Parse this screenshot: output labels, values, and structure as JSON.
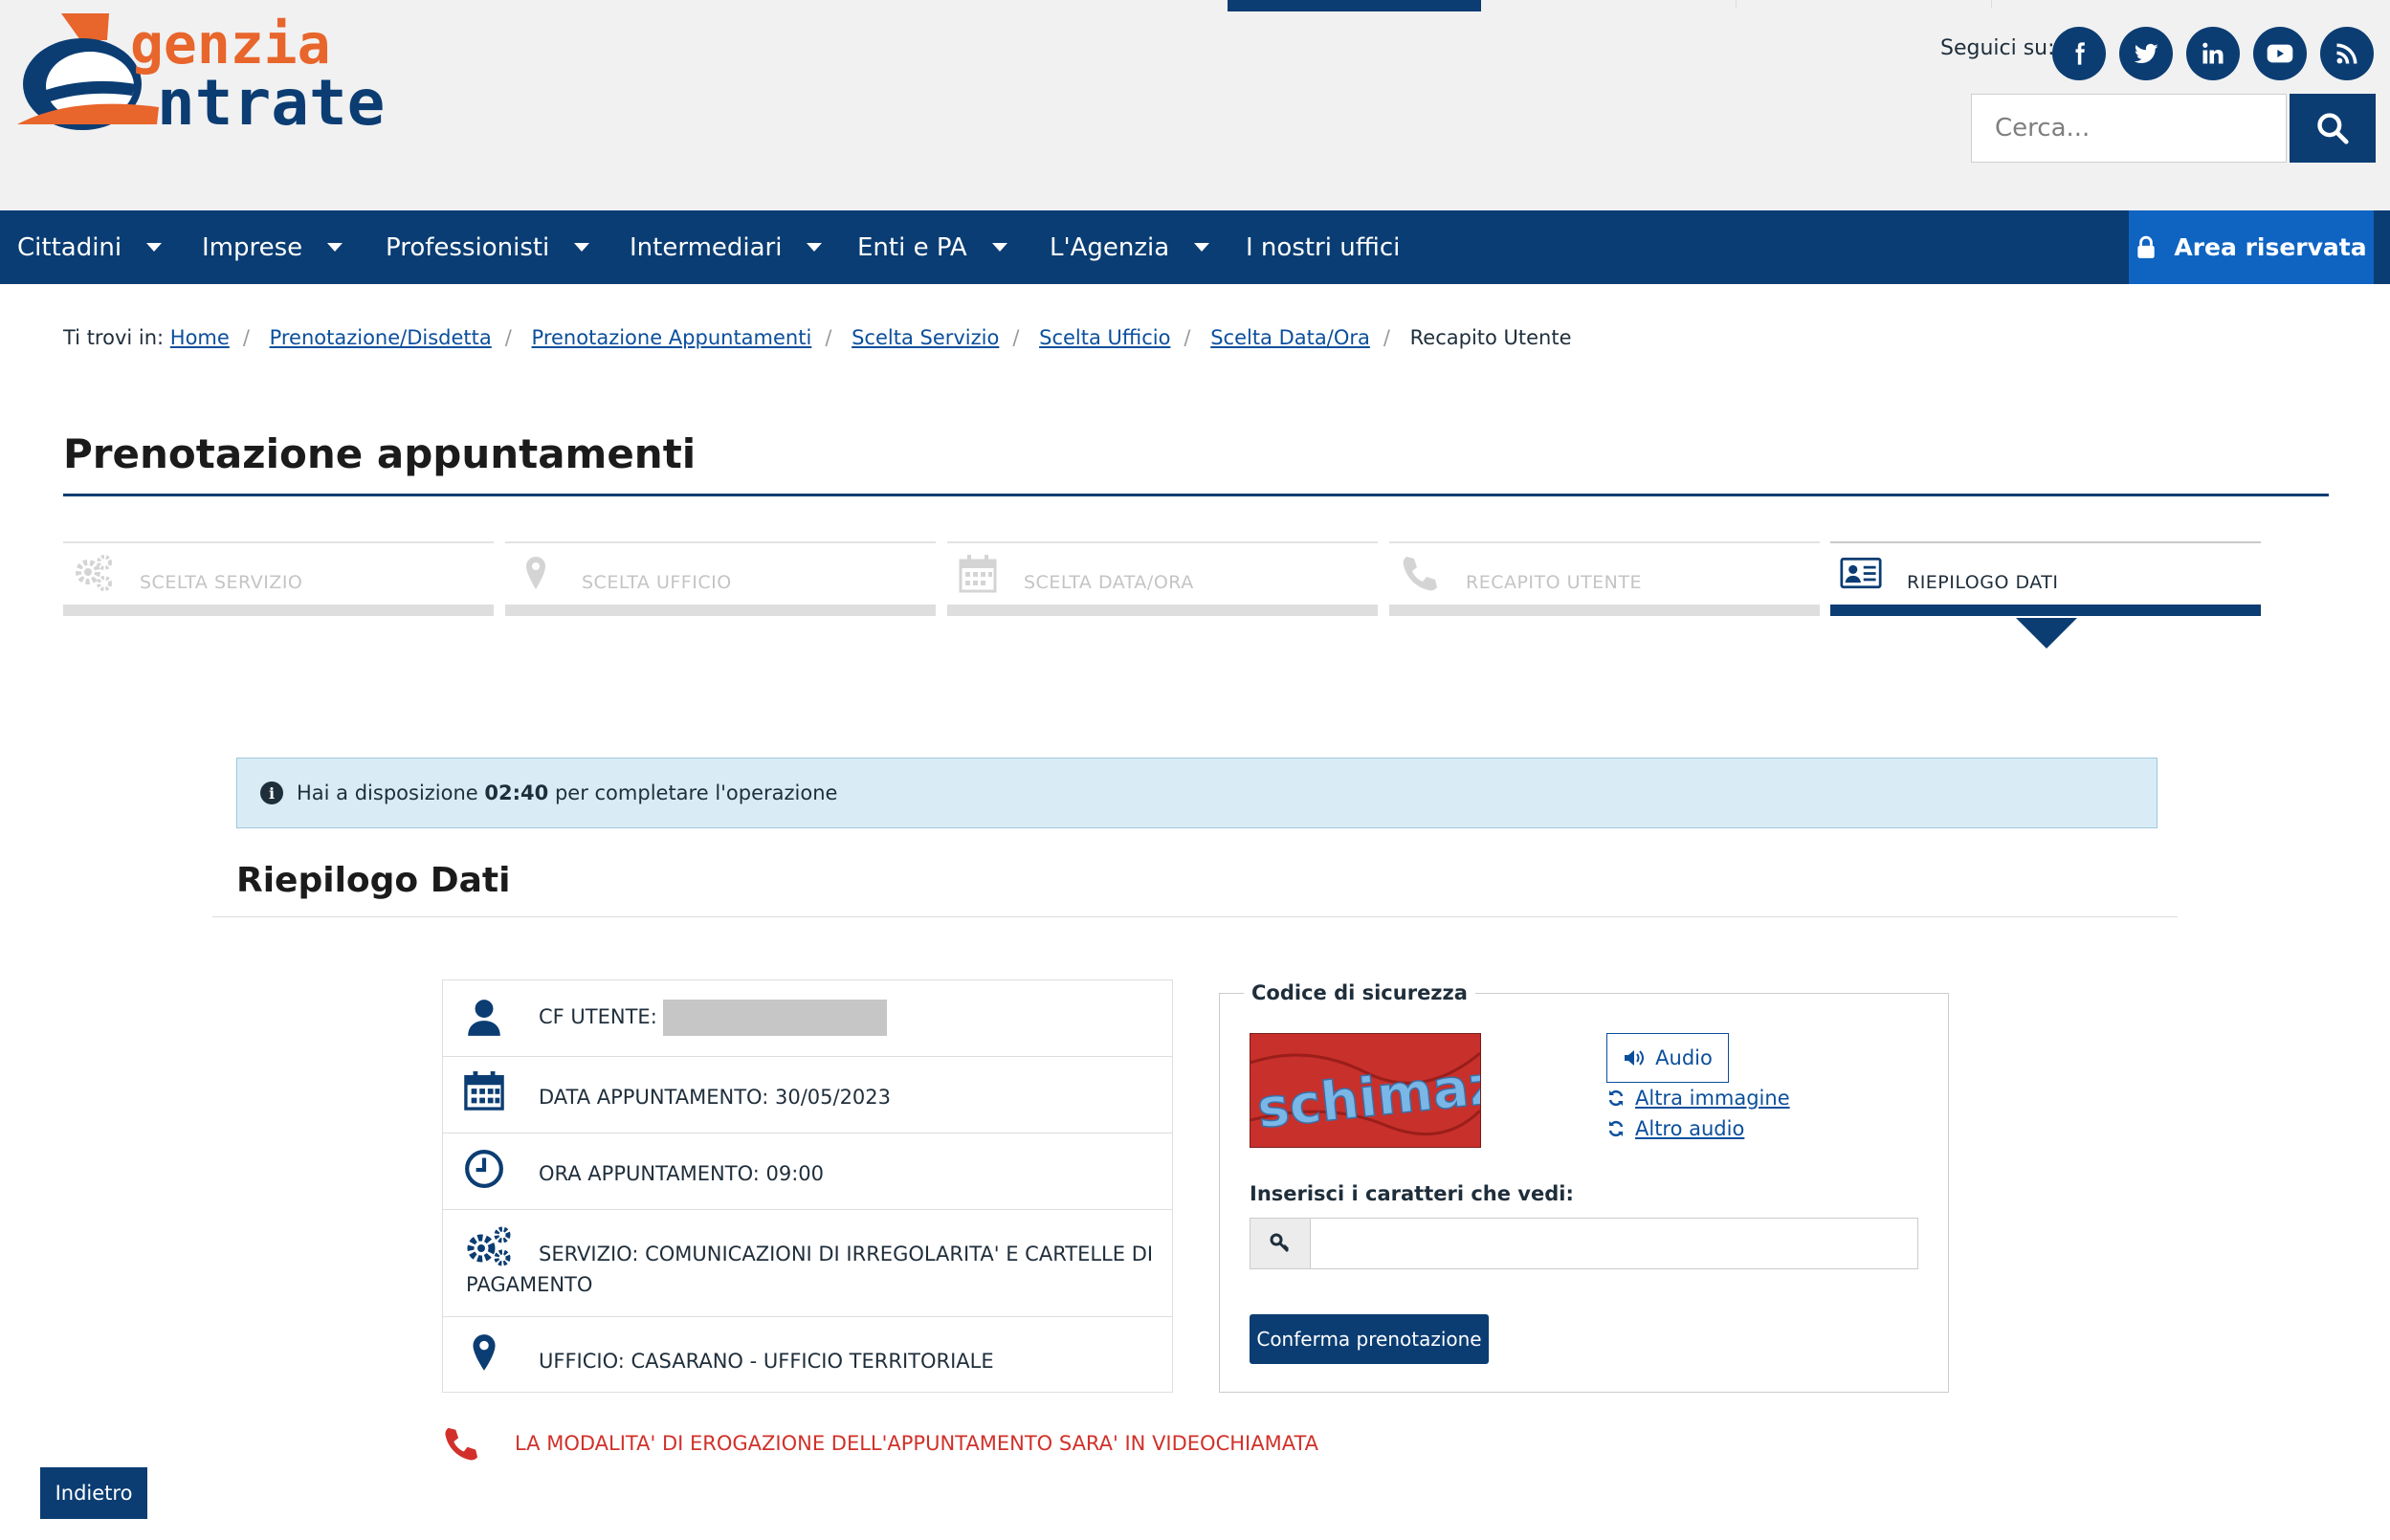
{
  "header": {
    "logo": {
      "line1": "genzia",
      "line2": "ntrate",
      "letter": "A"
    },
    "follow_label": "Seguici su:",
    "social": [
      "facebook-icon",
      "twitter-icon",
      "linkedin-icon",
      "youtube-icon",
      "rss-icon"
    ],
    "search": {
      "placeholder": "Cerca..."
    }
  },
  "nav": {
    "items": [
      {
        "label": "Cittadini",
        "dropdown": true
      },
      {
        "label": "Imprese",
        "dropdown": true
      },
      {
        "label": "Professionisti",
        "dropdown": true
      },
      {
        "label": "Intermediari",
        "dropdown": true
      },
      {
        "label": "Enti e PA",
        "dropdown": true
      },
      {
        "label": "L'Agenzia",
        "dropdown": true
      },
      {
        "label": "I nostri uffici",
        "dropdown": false
      }
    ],
    "area_riservata": "Area riservata"
  },
  "breadcrumb": {
    "prefix": "Ti trovi in:",
    "links": [
      "Home",
      "Prenotazione/Disdetta",
      "Prenotazione Appuntamenti",
      "Scelta Servizio",
      "Scelta Ufficio",
      "Scelta Data/Ora"
    ],
    "current": "Recapito Utente"
  },
  "page_title": "Prenotazione appuntamenti",
  "steps": [
    {
      "label": "SCELTA SERVIZIO",
      "icon": "gears-icon",
      "active": false
    },
    {
      "label": "SCELTA UFFICIO",
      "icon": "map-pin-icon",
      "active": false
    },
    {
      "label": "SCELTA DATA/ORA",
      "icon": "calendar-icon",
      "active": false
    },
    {
      "label": "RECAPITO UTENTE",
      "icon": "phone-icon",
      "active": false
    },
    {
      "label": "RIEPILOGO DATI",
      "icon": "id-card-icon",
      "active": true
    }
  ],
  "alert": {
    "prefix": "Hai a disposizione",
    "time": "02:40",
    "suffix": "per completare l'operazione"
  },
  "summary": {
    "title": "Riepilogo Dati",
    "cf_label": "CF UTENTE:",
    "data_label": "DATA APPUNTAMENTO:",
    "data_value": "30/05/2023",
    "ora_label": "ORA APPUNTAMENTO:",
    "ora_value": "09:00",
    "servizio_line1": "SERVIZIO: COMUNICAZIONI DI IRREGOLARITA' E CARTELLE DI",
    "servizio_line2": "PAGAMENTO",
    "ufficio": "UFFICIO: CASARANO - UFFICIO TERRITORIALE"
  },
  "captcha": {
    "legend": "Codice di sicurezza",
    "image_text": "schimaze",
    "audio_label": "Audio",
    "altra_immagine": "Altra immagine",
    "altro_audio": "Altro audio",
    "insert_label": "Inserisci i caratteri che vedi:",
    "input_value": "",
    "confirm_label": "Conferma prenotazione"
  },
  "video_note": "LA MODALITA' DI EROGAZIONE DELL'APPUNTAMENTO SARA' IN VIDEOCHIAMATA",
  "back_label": "Indietro",
  "colors": {
    "brand_blue": "#0a3d73",
    "accent_blue": "#0f64c2",
    "logo_orange": "#e8652b",
    "alert_bg": "#d9ecf5",
    "warning_red": "#d1312a"
  }
}
